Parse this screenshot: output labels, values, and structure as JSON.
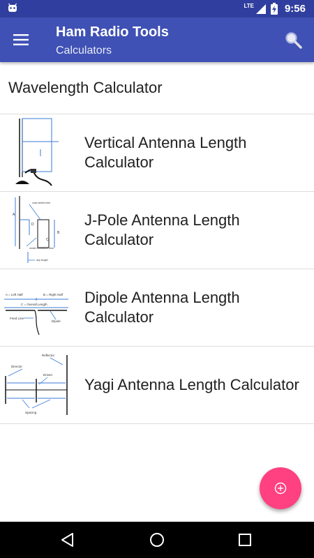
{
  "status_bar": {
    "network": "LTE",
    "time": "9:56"
  },
  "app_bar": {
    "title": "Ham Radio Tools",
    "subtitle": "Calculators",
    "menu_icon": "hamburger-menu-icon",
    "search_icon": "search-icon"
  },
  "list": {
    "header": "Wavelength Calculator",
    "items": [
      {
        "label": "Vertical Antenna Length Calculator",
        "icon": "vertical-antenna-diagram"
      },
      {
        "label": "J-Pole Antenna Length Calculator",
        "icon": "j-pole-antenna-diagram",
        "diagram_text": {
          "coax": "coax shield here",
          "center": "center conductor here",
          "any": "any length",
          "A": "A",
          "B": "B",
          "C": "C",
          "D": "D"
        }
      },
      {
        "label": "Dipole Antenna Length Calculator",
        "icon": "dipole-antenna-diagram",
        "diagram_text": {
          "left": "A = Left Half",
          "right": "B = Right Half",
          "overall": "C = Overall Length",
          "feed": "Feed Line",
          "dipole": "Dipole"
        }
      },
      {
        "label": "Yagi Antenna Length Calculator",
        "icon": "yagi-antenna-diagram",
        "diagram_text": {
          "reflector": "Reflector",
          "director": "Director",
          "driven": "Driven",
          "spacing": "Spacing"
        }
      }
    ]
  },
  "fab": {
    "icon": "add-circle-icon"
  },
  "nav_bar": {
    "back_icon": "back-icon",
    "home_icon": "home-icon",
    "recents_icon": "recents-icon"
  },
  "colors": {
    "status_bar": "#303f9f",
    "app_bar": "#3f51b5",
    "fab": "#ff4081",
    "diagram_blue": "#3a7bd5"
  }
}
